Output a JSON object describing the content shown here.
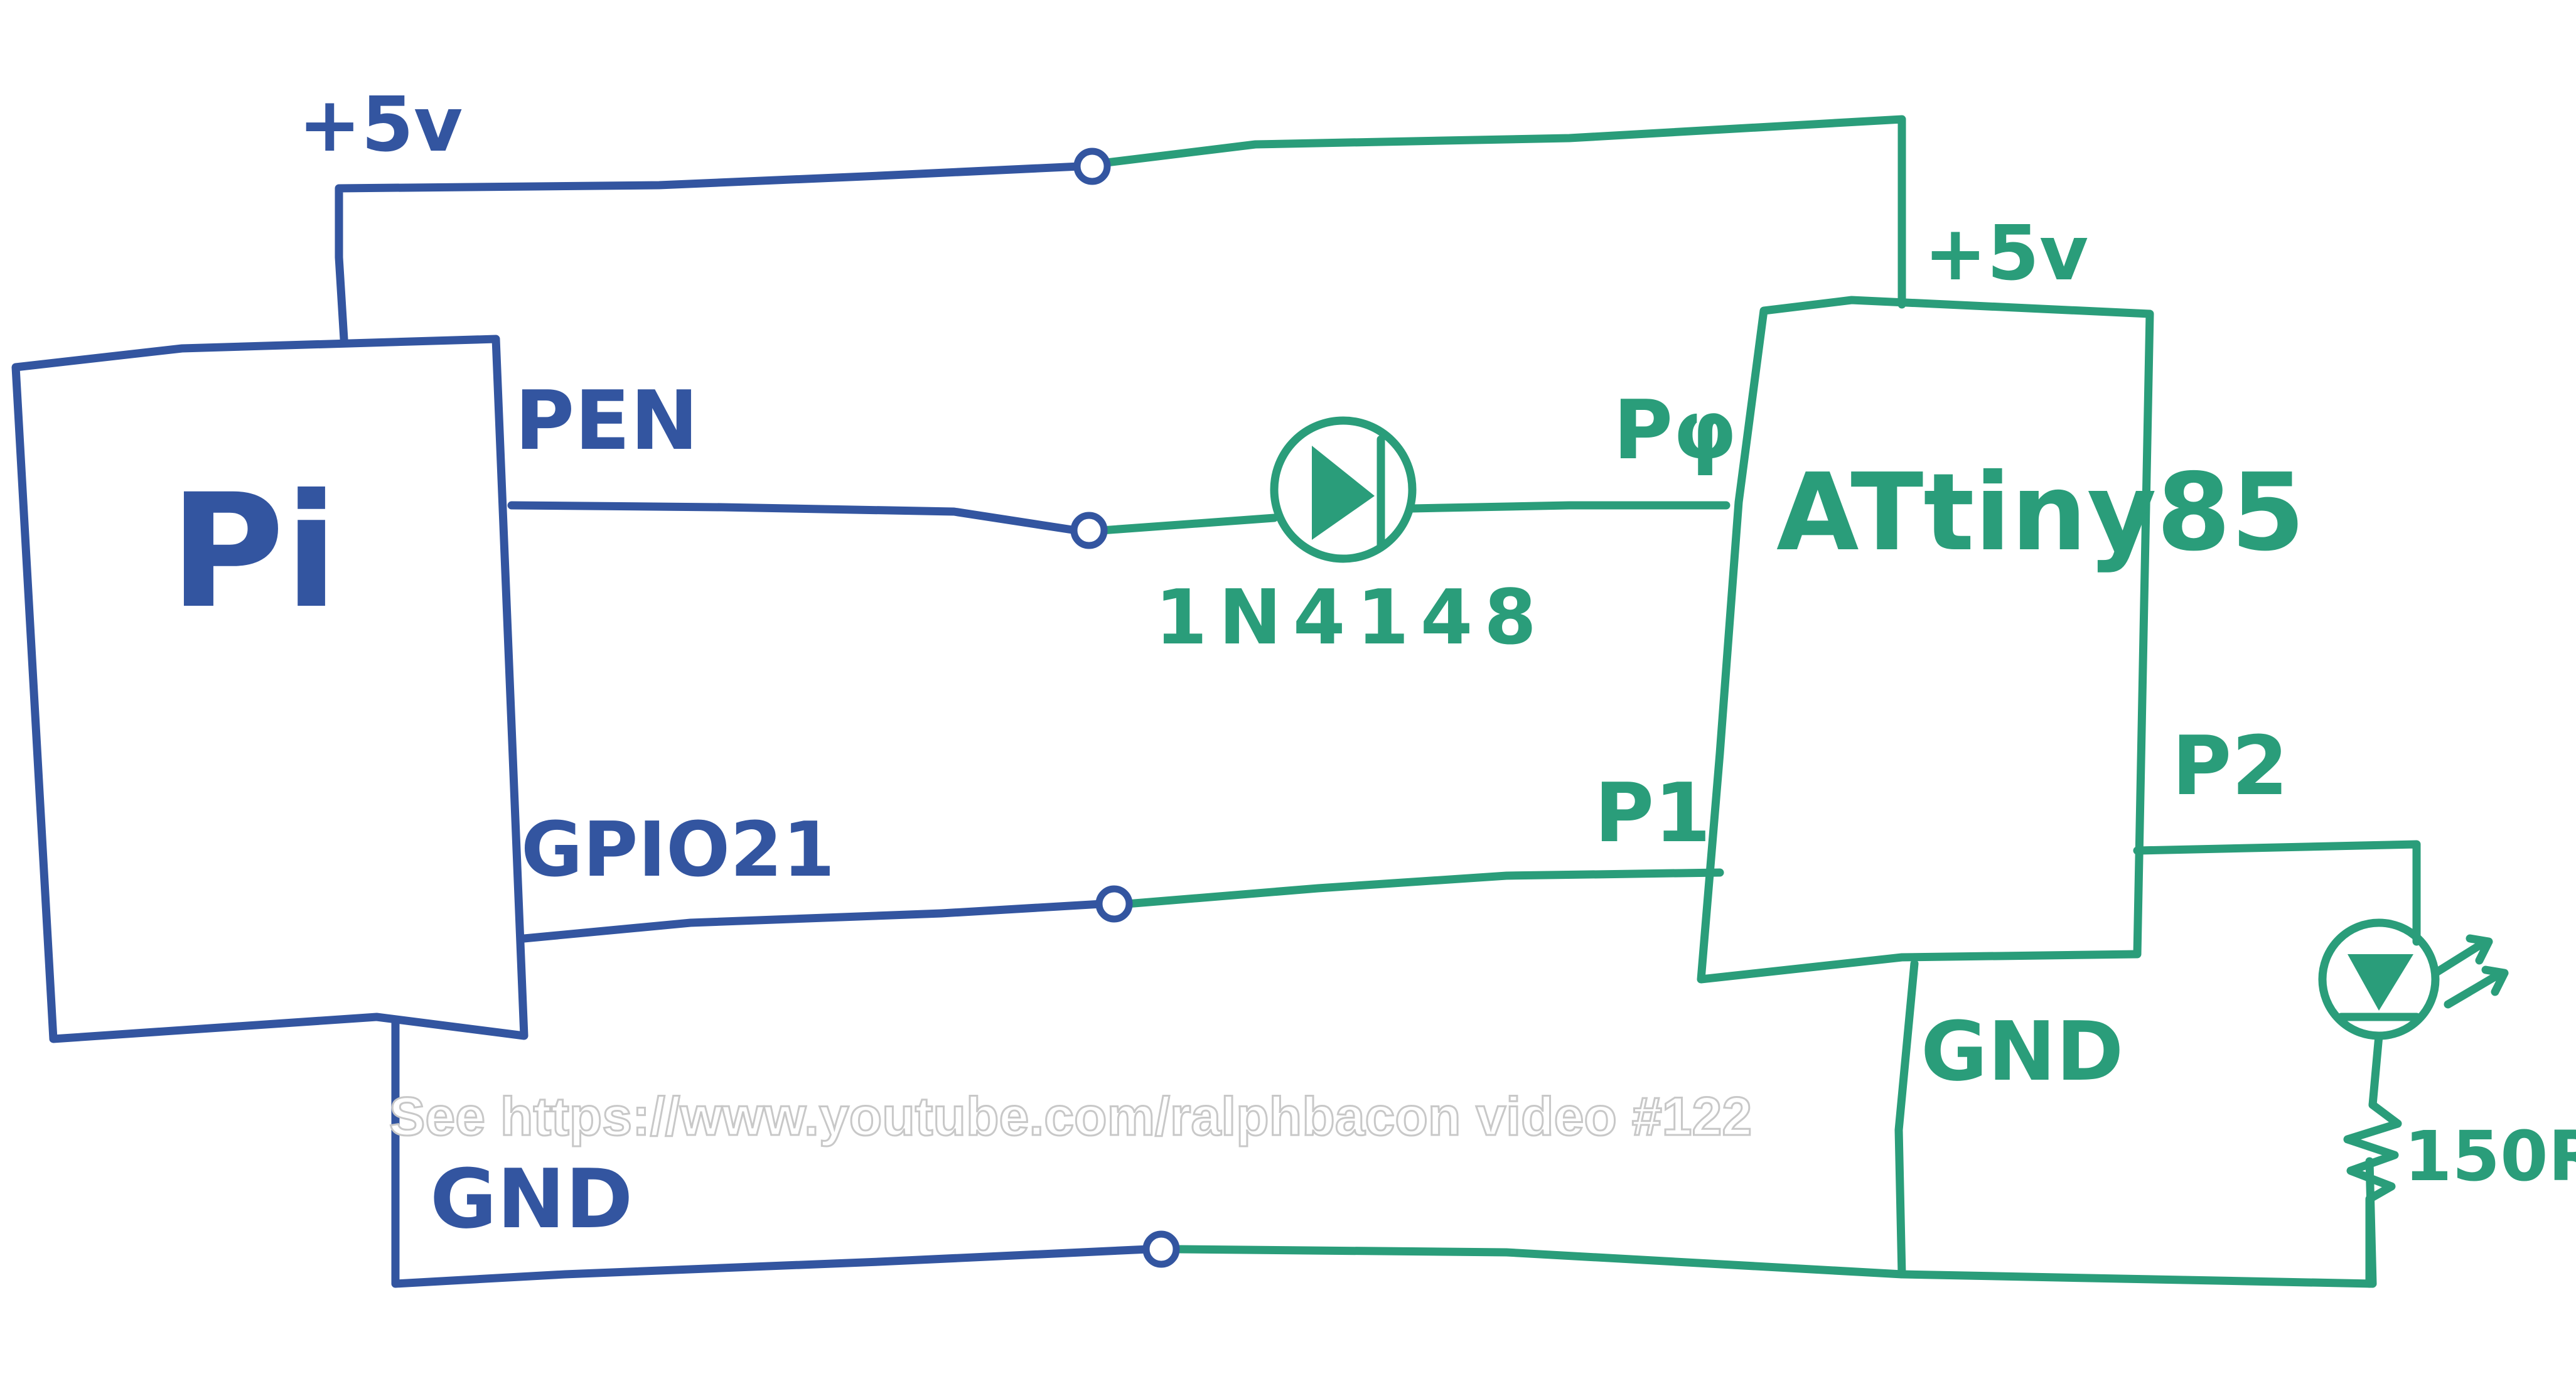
{
  "colors": {
    "pi_side": "#3355a0",
    "attiny_side": "#2a9d7a",
    "watermark": "#ffffff"
  },
  "pi": {
    "title": "Pi",
    "plus5v_label": "+5v",
    "pen_label": "PEN",
    "gpio_label": "GPIO21",
    "gnd_label": "GND"
  },
  "attiny": {
    "title": "ATtiny85",
    "plus5v_label": "+5v",
    "p0_label": "Pφ",
    "p1_label": "P1",
    "p2_label": "P2",
    "gnd_label": "GND"
  },
  "diode": {
    "label": "1N4148"
  },
  "led": {
    "resistor_label": "150R"
  },
  "watermark": {
    "text": "See https://www.youtube.com/ralphbacon video #122"
  }
}
